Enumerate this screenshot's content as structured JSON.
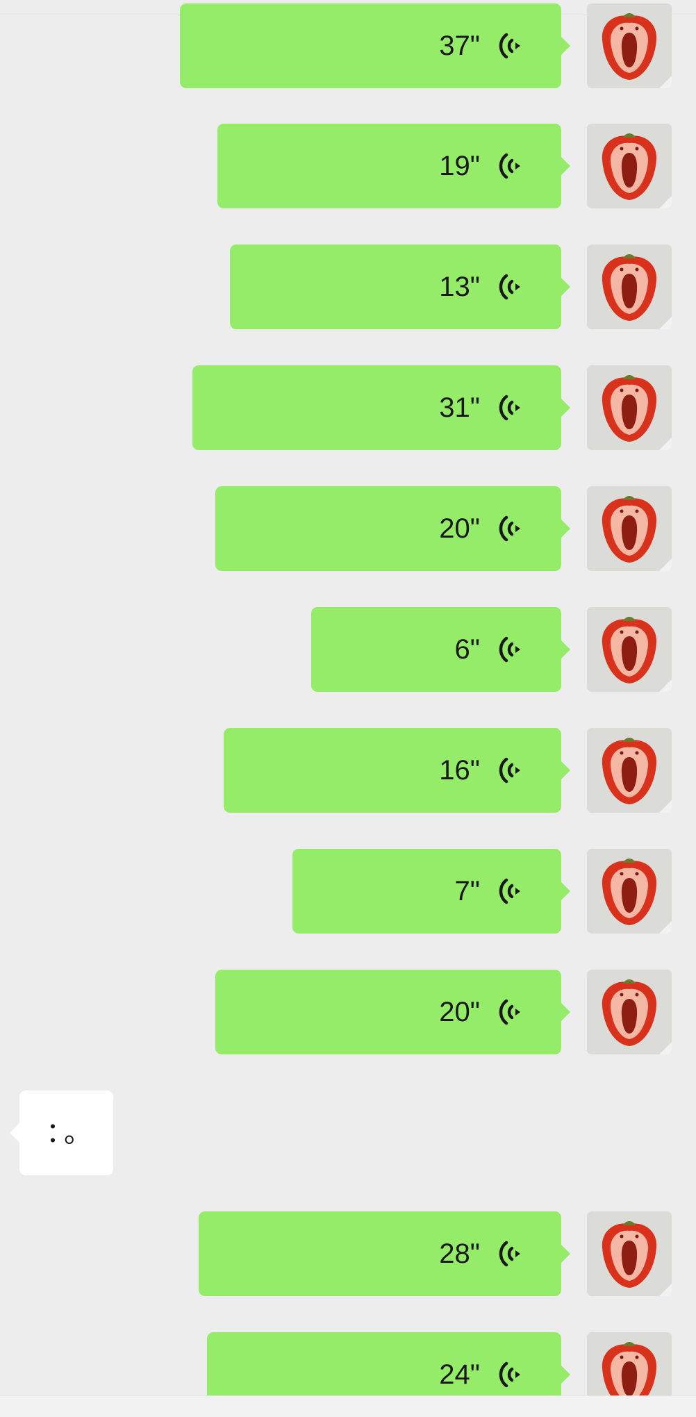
{
  "chat": {
    "incoming_message": "：。",
    "outgoing_voice_messages": [
      {
        "duration": "37\""
      },
      {
        "duration": "19\""
      },
      {
        "duration": "13\""
      },
      {
        "duration": "31\""
      },
      {
        "duration": "20\""
      },
      {
        "duration": "6\""
      },
      {
        "duration": "16\""
      },
      {
        "duration": "7\""
      },
      {
        "duration": "20\""
      },
      {
        "duration": "28\""
      },
      {
        "duration": "24\""
      }
    ]
  },
  "icons": {
    "voice": "voice-wave-icon",
    "avatar": "red-pepper-avatar"
  },
  "colors": {
    "background": "#ededed",
    "outgoing_bubble": "#95ec69",
    "incoming_bubble": "#ffffff",
    "text": "#191919"
  }
}
